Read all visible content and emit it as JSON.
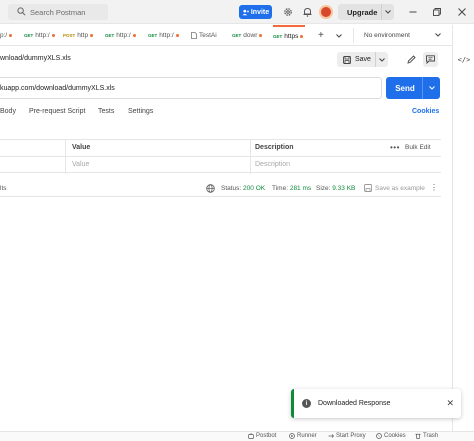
{
  "topbar": {
    "search_placeholder": "Search Postman",
    "invite_label": "Invite",
    "upgrade_label": "Upgrade"
  },
  "tabs": [
    {
      "method": "",
      "label": "p:/",
      "dot": true
    },
    {
      "method": "GET",
      "label": "http:/",
      "dot": true
    },
    {
      "method": "POST",
      "label": "http",
      "dot": true
    },
    {
      "method": "GET",
      "label": "http:/",
      "dot": true
    },
    {
      "method": "GET",
      "label": "http:/",
      "dot": true
    },
    {
      "method": "",
      "label": "TestAi",
      "dot": false
    },
    {
      "method": "GET",
      "label": "dowr",
      "dot": true
    },
    {
      "method": "GET",
      "label": "https",
      "dot": true
    }
  ],
  "environment": {
    "selected": "No environment"
  },
  "request": {
    "name": "wnload/dummyXLS.xls",
    "url": "kuapp.com/download/dummyXLS.xls",
    "save_label": "Save",
    "send_label": "Send"
  },
  "subtabs": {
    "body": "Body",
    "prerequest": "Pre-request Script",
    "tests": "Tests",
    "settings": "Settings",
    "cookies": "Cookies"
  },
  "params": {
    "headers": {
      "value": "Value",
      "description": "Description",
      "bulk_edit": "Bulk Edit"
    },
    "placeholders": {
      "value": "Value",
      "description": "Description"
    }
  },
  "response": {
    "label": "lts",
    "status_label": "Status:",
    "status_value": "200 OK",
    "time_label": "Time:",
    "time_value": "281 ms",
    "size_label": "Size:",
    "size_value": "9.33 KB",
    "save_example": "Save as example"
  },
  "toast": {
    "message": "Downloaded Response"
  },
  "footer": {
    "postbot": "Postbot",
    "runner": "Runner",
    "proxy": "Start Proxy",
    "cookies": "Cookies",
    "trash": "Trash"
  },
  "colors": {
    "accent": "#1f6feb",
    "brand": "#f26b3a",
    "success": "#0f8a3d"
  },
  "icons": [
    "search-icon",
    "settings-icon",
    "bell-icon",
    "chevron-down-icon",
    "minimize-icon",
    "restore-icon",
    "close-icon",
    "plus-icon",
    "more-icon",
    "save-icon",
    "edit-icon",
    "comment-icon",
    "code-icon",
    "globe-icon",
    "info-icon",
    "cookie-icon",
    "trash-icon",
    "play-icon",
    "proxy-icon",
    "bot-icon"
  ]
}
